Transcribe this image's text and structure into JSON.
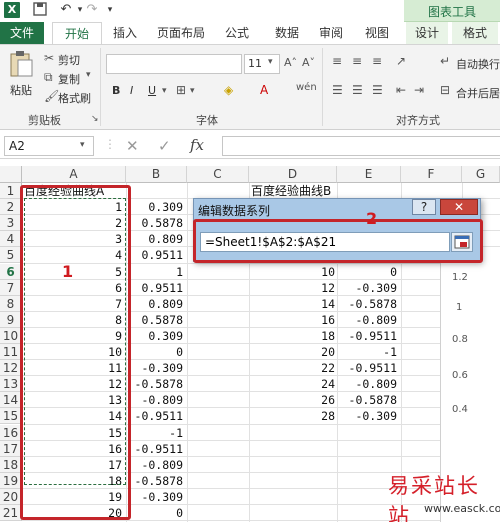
{
  "app": {
    "logo_letter": "X"
  },
  "ribbon_context": {
    "chart_tools": "图表工具"
  },
  "tabs": [
    {
      "label": "文件"
    },
    {
      "label": "开始"
    },
    {
      "label": "插入"
    },
    {
      "label": "页面布局"
    },
    {
      "label": "公式"
    },
    {
      "label": "数据"
    },
    {
      "label": "审阅"
    },
    {
      "label": "视图"
    },
    {
      "label": "设计"
    },
    {
      "label": "格式"
    }
  ],
  "clipboard": {
    "paste": "粘贴",
    "cut": "剪切",
    "copy": "复制",
    "format_painter": "格式刷",
    "group_label": "剪贴板"
  },
  "font_group": {
    "size": "11",
    "bold": "B",
    "italic": "I",
    "underline": "U",
    "group_label": "字体"
  },
  "alignment_group": {
    "wrap": "自动换行",
    "merge": "合并后居",
    "group_label": "对齐方式"
  },
  "formula_bar": {
    "name_box": "A2",
    "fx": "fx",
    "cancel": "✕",
    "enter": "✓"
  },
  "columns": [
    "A",
    "B",
    "C",
    "D",
    "E",
    "F",
    "G"
  ],
  "rows": [
    "1",
    "2",
    "3",
    "4",
    "5",
    "6",
    "7",
    "8",
    "9",
    "10",
    "11",
    "12",
    "13",
    "14",
    "15",
    "16",
    "17",
    "18",
    "19",
    "20",
    "21"
  ],
  "cells": {
    "A": [
      "百度经验曲线A",
      "1",
      "2",
      "3",
      "4",
      "5",
      "6",
      "7",
      "8",
      "9",
      "10",
      "11",
      "12",
      "13",
      "14",
      "15",
      "16",
      "17",
      "18",
      "19",
      "20"
    ],
    "B": [
      "",
      "0.309",
      "0.5878",
      "0.809",
      "0.9511",
      "1",
      "0.9511",
      "0.809",
      "0.5878",
      "0.309",
      "0",
      "-0.309",
      "-0.5878",
      "-0.809",
      "-0.9511",
      "-1",
      "-0.9511",
      "-0.809",
      "-0.5878",
      "-0.309",
      "0"
    ],
    "D": [
      "百度经验曲线B",
      "",
      "",
      "",
      "",
      "10",
      "12",
      "14",
      "16",
      "18",
      "20",
      "22",
      "24",
      "26",
      "28",
      "",
      "",
      "",
      "",
      "",
      ""
    ],
    "E": [
      "",
      "",
      "",
      "",
      "",
      "0",
      "-0.309",
      "-0.5878",
      "-0.809",
      "-0.9511",
      "-1",
      "-0.9511",
      "-0.809",
      "-0.5878",
      "-0.309",
      "",
      "",
      "",
      "",
      "",
      ""
    ]
  },
  "chart_axis": [
    "1.2",
    "1",
    "0.8",
    "0.6",
    "0.4"
  ],
  "dialog": {
    "title": "编辑数据系列",
    "help": "?",
    "close": "✕",
    "input_value": "=Sheet1!$A$2:$A$21"
  },
  "annotations": {
    "label_1": "1",
    "label_2": "2"
  },
  "watermark": {
    "text": "易采站长站",
    "url": "www.easck.com"
  }
}
